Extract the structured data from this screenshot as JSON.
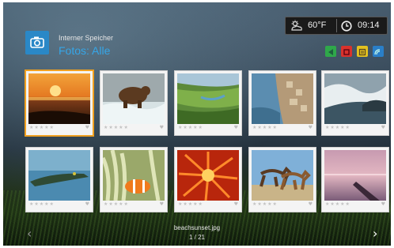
{
  "header": {
    "storage_label": "Interner Speicher",
    "section": "Fotos",
    "separator": ":",
    "filter": "Alle",
    "title_color": "#35a6e8",
    "app_icon": "camera-icon"
  },
  "status": {
    "weather_icon": "weather-icon",
    "temperature": "60°F",
    "clock_icon": "clock-icon",
    "time": "09:14"
  },
  "color_buttons": [
    {
      "name": "green",
      "color": "#2fa84a",
      "icon": "back-icon"
    },
    {
      "name": "red",
      "color": "#d8322c",
      "icon": "square-icon"
    },
    {
      "name": "yellow",
      "color": "#e4c21f",
      "icon": "list-icon"
    },
    {
      "name": "blue",
      "color": "#2a7fc8",
      "icon": "wifi-icon"
    }
  ],
  "photos": [
    {
      "subject": "beach sunset",
      "selected": true
    },
    {
      "subject": "bear in river"
    },
    {
      "subject": "green landscape"
    },
    {
      "subject": "coastal town"
    },
    {
      "subject": "ocean waves"
    },
    {
      "subject": "crocodile"
    },
    {
      "subject": "clownfish anemone"
    },
    {
      "subject": "red sea anemone"
    },
    {
      "subject": "horses running"
    },
    {
      "subject": "pink sunset lake"
    }
  ],
  "footer": {
    "filename": "beachsunset.jpg",
    "page_counter": "1 / 21",
    "prev": "‹",
    "next": "›"
  }
}
